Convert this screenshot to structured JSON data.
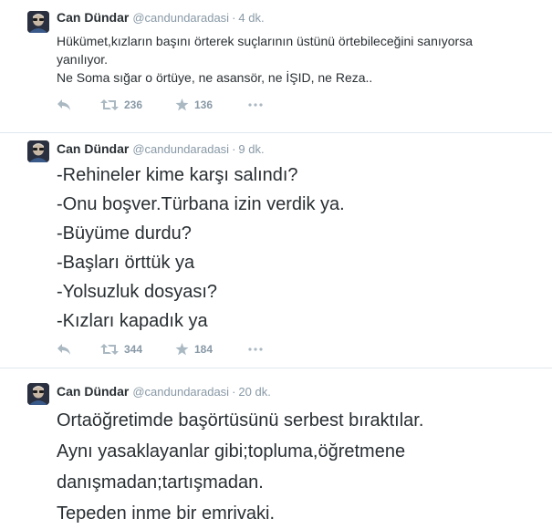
{
  "tweets": [
    {
      "name": "Can Dündar",
      "handle": "@candundaradasi",
      "separator": "·",
      "time": "4 dk.",
      "lines": [
        "Hükümet,kızların başını örterek suçlarının üstünü örtebileceğini sanıyorsa",
        "yanılıyor.",
        "Ne Soma sığar o örtüye, ne asansör, ne İŞID, ne Reza.."
      ],
      "retweets": "236",
      "favorites": "136"
    },
    {
      "name": "Can Dündar",
      "handle": "@candundaradasi",
      "separator": "·",
      "time": "9 dk.",
      "lines": [
        "-Rehineler kime karşı salındı?",
        "-Onu boşver.Türbana izin verdik ya.",
        "-Büyüme durdu?",
        "-Başları örttük ya",
        "-Yolsuzluk dosyası?",
        "-Kızları kapadık ya"
      ],
      "retweets": "344",
      "favorites": "184"
    },
    {
      "name": "Can Dündar",
      "handle": "@candundaradasi",
      "separator": "·",
      "time": "20 dk.",
      "lines": [
        "Ortaöğretimde başörtüsünü serbest bıraktılar.",
        "Aynı yasaklayanlar gibi;topluma,öğretmene",
        "danışmadan;tartışmadan.",
        "Tepeden inme bir emrivaki."
      ]
    }
  ],
  "icons": {
    "reply": "reply-icon",
    "retweet": "retweet-icon",
    "favorite": "star-icon",
    "more": "more-icon"
  },
  "colors": {
    "text": "#292f33",
    "meta": "#8899a6",
    "action_icon": "#aab8c2",
    "divider": "#e1e8ed"
  }
}
